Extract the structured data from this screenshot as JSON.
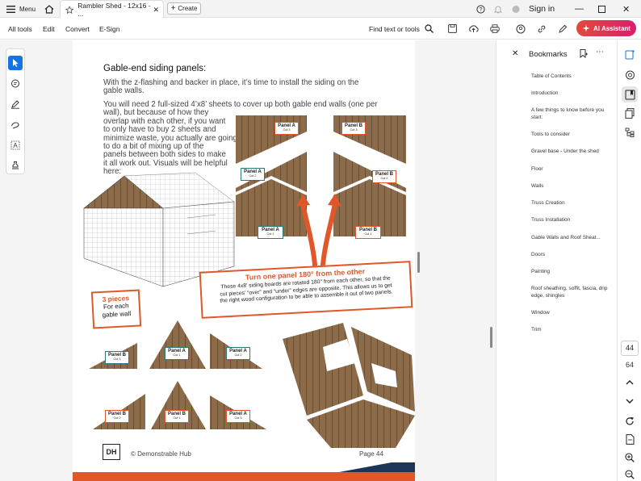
{
  "topbar": {
    "menu_label": "Menu",
    "tab_title": "Rambler Shed - 12x16 - ...",
    "create_label": "Create",
    "sign_in": "Sign in"
  },
  "toolbar": {
    "menus": [
      "All tools",
      "Edit",
      "Convert",
      "E-Sign"
    ],
    "find_label": "Find text or tools",
    "ai_label": "AI Assistant"
  },
  "document": {
    "heading": "Gable-end siding panels:",
    "para1": "With the z-flashing and backer in place, it’s time to install the siding on the gable walls.",
    "para2_lines": [
      "You will need 2 full-sized 4’x8’ sheets to cover up both gable end walls (one per",
      "wall), but because of how they",
      "overlap with each other, if you want",
      "to only have to buy 2 sheets and",
      "minimize waste, you actually are going",
      "to do a bit of mixing up of the",
      "panels between both sides to make",
      "it all work out.  Visuals will be helpful",
      "here:"
    ],
    "callout_title": "Turn one panel 180° from the other",
    "callout_body": [
      "These 4x8’ siding boards are rotated 180° from each other, so that the",
      "cut pieces’ “over” and “under” edges are opposite.  This allows us to get",
      "the right wood configuration to be able to assemble it out of two panels."
    ],
    "pieces_title": "3 pieces",
    "pieces_line1": "For each",
    "pieces_line2": "gable wall",
    "footer_logo": "DH",
    "footer_brand": "© Demonstrable Hub",
    "footer_page": "Page 44",
    "labels": {
      "panel_a": "Panel A",
      "panel_b": "Panel B",
      "cut1": "Cut 1",
      "cut2": "Cut 2",
      "cut3": "Cut 3"
    }
  },
  "bookmarks": {
    "title": "Bookmarks",
    "items": [
      "Table of Contents",
      "Introduction",
      "A few things to know before you start:",
      "Tools to consider",
      "Gravel base - Under the shed",
      "Floor",
      "Walls",
      "Truss Creation",
      "Truss Installation",
      "Gable Walls and Roof Sheat...",
      "Doors",
      "Painting",
      "Roof sheathing, soffit, fascia, drip edge, shingles",
      "Window",
      "Trim"
    ]
  },
  "page_nav": {
    "current_page": "44",
    "total_pages": "64"
  },
  "colors": {
    "accent_blue": "#1473e6",
    "orange": "#e0582a",
    "teal": "#2c7a78",
    "wood": "#8b6b4a",
    "footer_bar": "#e0582a",
    "footer_dark": "#1d3557"
  },
  "icons": [
    "menu-icon",
    "home-icon",
    "star-icon",
    "plus-icon",
    "help-icon",
    "bell-icon",
    "search-icon",
    "save-icon",
    "upload-icon",
    "print-icon",
    "link-icon",
    "pen-icon",
    "cursor-icon",
    "comment-icon",
    "highlight-icon",
    "draw-icon",
    "text-select-icon",
    "stamp-icon",
    "bookmark-icon"
  ]
}
